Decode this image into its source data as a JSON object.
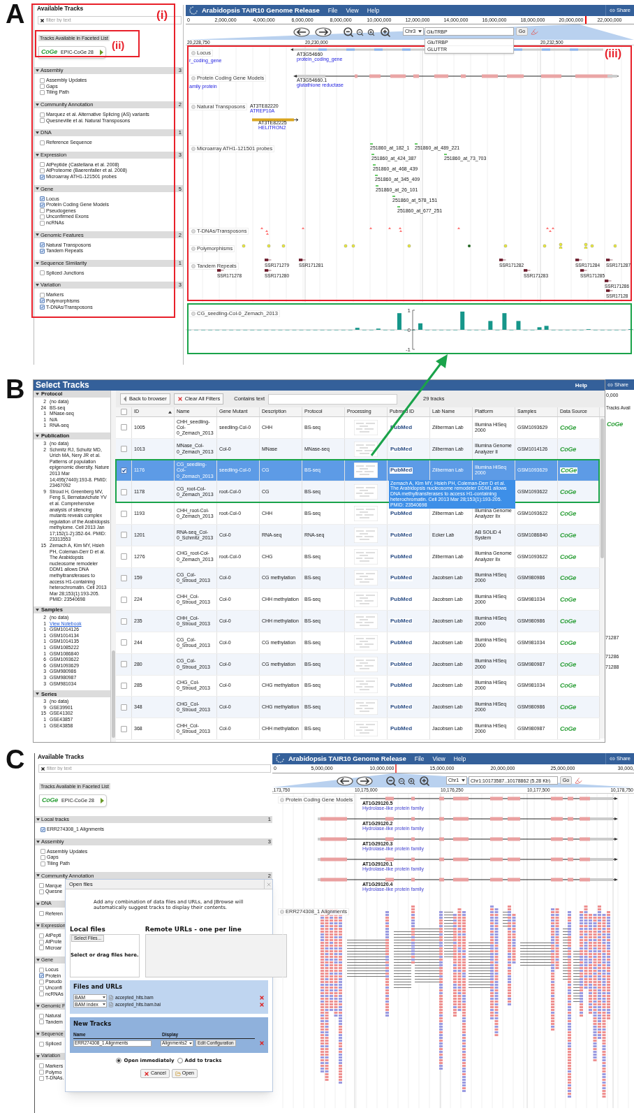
{
  "panel_a": {
    "label": "A",
    "callouts": [
      "(i)",
      "(ii)",
      "(iii)"
    ],
    "sidebar": {
      "title": "Available Tracks",
      "filter_placeholder": "filter by text",
      "faceted_label": "Tracks Available in Faceted List",
      "source": {
        "logo": "CoGe",
        "label": "EPIC-CoGe 28"
      },
      "categories": [
        {
          "name": "Assembly",
          "count": "3",
          "tracks": [
            {
              "label": "Assembly Updates",
              "checked": false
            },
            {
              "label": "Gaps",
              "checked": false
            },
            {
              "label": "Tiling Path",
              "checked": false
            }
          ]
        },
        {
          "name": "Community Annotation",
          "count": "2",
          "tracks": [
            {
              "label": "Marquez et al. Alternative Splicing (AS) variants",
              "checked": false
            },
            {
              "label": "Quesneville et al. Natural Transposons",
              "checked": false
            }
          ]
        },
        {
          "name": "DNA",
          "count": "1",
          "tracks": [
            {
              "label": "Reference Sequence",
              "checked": false
            }
          ]
        },
        {
          "name": "Expression",
          "count": "3",
          "tracks": [
            {
              "label": "AtPeptide (Castellana et al. 2008)",
              "checked": false
            },
            {
              "label": "AtProteome (Baerenfaller et al. 2008)",
              "checked": false
            },
            {
              "label": "Microarray ATH1-121501 probes",
              "checked": true
            }
          ]
        },
        {
          "name": "Gene",
          "count": "5",
          "tracks": [
            {
              "label": "Locus",
              "checked": true
            },
            {
              "label": "Protein Coding Gene Models",
              "checked": true
            },
            {
              "label": "Pseudogenes",
              "checked": false
            },
            {
              "label": "Unconfirmed Exons",
              "checked": false
            },
            {
              "label": "ncRNAs",
              "checked": false
            }
          ]
        },
        {
          "name": "Genomic Features",
          "count": "2",
          "tracks": [
            {
              "label": "Natural Transposons",
              "checked": true
            },
            {
              "label": "Tandem Repeats",
              "checked": true
            }
          ]
        },
        {
          "name": "Sequence Similarity",
          "count": "1",
          "tracks": [
            {
              "label": "Spliced Junctions",
              "checked": false
            }
          ]
        },
        {
          "name": "Variation",
          "count": "3",
          "tracks": [
            {
              "label": "Markers",
              "checked": false
            },
            {
              "label": "Polymorphisms",
              "checked": true
            },
            {
              "label": "T-DNAs/Transposons",
              "checked": true
            }
          ]
        }
      ]
    },
    "browser": {
      "title": "Arabidopsis TAIR10 Genome Release",
      "menus": [
        "File",
        "View",
        "Help"
      ],
      "share": "Share",
      "overview_ticks": [
        "0",
        "2,000,000",
        "4,000,000",
        "6,000,000",
        "8,000,000",
        "10,000,000",
        "12,000,000",
        "14,000,000",
        "16,000,000",
        "18,000,000",
        "20,000,000",
        "22,000,000"
      ],
      "chromosome": "Chr3",
      "search": {
        "value": "GluTRBP"
      },
      "go": "Go",
      "suggestions": [
        "GluTRBP",
        "GLUTTR"
      ],
      "detail_ticks": [
        "20,228,750",
        "20,230,000",
        "20,232,500"
      ],
      "tracks": [
        {
          "kind": "gene",
          "label": "Locus",
          "features": [
            {
              "note": "r_coding_gene"
            },
            {
              "name": "AT3G54660",
              "note": "protein_coding_gene"
            }
          ]
        },
        {
          "kind": "transcript",
          "label": "Protein Coding Gene Models",
          "features": [
            {
              "note": "amily protein"
            },
            {
              "name": "AT3G54660.1",
              "note": "glutathione reductase"
            }
          ]
        },
        {
          "kind": "transposon",
          "label": "Natural Transposons",
          "features": [
            {
              "name": "AT3TE82220",
              "note": "ATREP10A"
            },
            {
              "name": "AT3TE82225",
              "note": "HELITRON2"
            }
          ]
        },
        {
          "kind": "probe",
          "label": "Microarray ATH1-121501 probes",
          "features": [
            {
              "name": "251860_at_182_1"
            },
            {
              "name": "251860_at_489_221"
            },
            {
              "name": "251860_at_424_387"
            },
            {
              "name": "251860_at_73_703"
            },
            {
              "name": "251860_at_468_439"
            },
            {
              "name": "251860_at_345_409"
            },
            {
              "name": "251860_at_26_101"
            },
            {
              "name": "251860_at_578_151"
            },
            {
              "name": "251860_at_677_251"
            }
          ]
        },
        {
          "kind": "insertion",
          "label": "T-DNAs/Transposons"
        },
        {
          "kind": "snp",
          "label": "Polymorphisms"
        },
        {
          "kind": "repeat",
          "label": "Tandem Repeats",
          "features": [
            {
              "name": "SSR171278"
            },
            {
              "name": "SSR171279"
            },
            {
              "name": "SSR171280"
            },
            {
              "name": "SSR171281"
            },
            {
              "name": "SSR171282"
            },
            {
              "name": "SSR171283"
            },
            {
              "name": "SSR171284"
            },
            {
              "name": "SSR171287"
            },
            {
              "name": "SSR171285"
            },
            {
              "name": "SSR171286"
            },
            {
              "name": "SSR17128"
            }
          ]
        }
      ],
      "chart_track": {
        "label": "CG_seedling-Col-0_Zemach_2013",
        "chart_data": {
          "type": "bar",
          "ylim": [
            -1,
            1
          ],
          "yticks": [
            -1,
            0,
            1
          ],
          "values": [
            0,
            0,
            0,
            0,
            0,
            0,
            0,
            0,
            0,
            0,
            0,
            0,
            0,
            0,
            0,
            0,
            0,
            0,
            0,
            0,
            0,
            0,
            0,
            0,
            0.1,
            0,
            0,
            0.06,
            0,
            0,
            0.85,
            0,
            0,
            0.33,
            0,
            0,
            0,
            0,
            0,
            0.93,
            0,
            0,
            0,
            0.45,
            0,
            0.85,
            0,
            0.45,
            0,
            0,
            0.13,
            0.2,
            0,
            0,
            0,
            0,
            0,
            0.03,
            0,
            0,
            0,
            0,
            0,
            0.03
          ]
        }
      }
    }
  },
  "panel_b": {
    "label": "B",
    "title": "Select Tracks",
    "help": "Help",
    "facets": [
      {
        "name": "Protocol",
        "values": [
          {
            "count": "2",
            "label": "(no data)"
          },
          {
            "count": "24",
            "label": "BS-seq"
          },
          {
            "count": "1",
            "label": "MNase-seq"
          },
          {
            "count": "1",
            "label": "N/A"
          },
          {
            "count": "1",
            "label": "RNA-seq"
          }
        ]
      },
      {
        "name": "Publication",
        "values": [
          {
            "count": "3",
            "label": "(no data)"
          },
          {
            "count": "2",
            "label": "Schmitz RJ, Schultz MD, Urich MA, Nery JR et al. Patterns of population epigenomic diversity. Nature 2013 Mar 14;495(7440):193-8. PMID: 23467092"
          },
          {
            "count": "9",
            "label": "Stroud H, Greenberg MV, Feng S, Bernatavichute YV et al. Comprehensive analysis of silencing mutants reveals complex regulation of the Arabidopsis methylome. Cell 2013 Jan 17;152(1-2):352-64. PMID: 23313553"
          },
          {
            "count": "15",
            "label": "Zemach A, Kim MY, Hsieh PH, Coleman-Derr D et al. The Arabidopsis nucleosome remodeler DDM1 allows DNA methyltransferases to access H1-containing heterochromatin. Cell 2013 Mar 28;153(1):193-205. PMID: 23540698"
          }
        ]
      },
      {
        "name": "Samples",
        "values": [
          {
            "kind": "text",
            "count": "2",
            "label": "(no data)"
          },
          {
            "kind": "link",
            "count": "1",
            "label": "View Notebook"
          },
          {
            "kind": "text",
            "count": "1",
            "label": "GSM1014126"
          },
          {
            "kind": "text",
            "count": "1",
            "label": "GSM1014134"
          },
          {
            "kind": "text",
            "count": "1",
            "label": "GSM1014135"
          },
          {
            "kind": "text",
            "count": "1",
            "label": "GSM1085222"
          },
          {
            "kind": "text",
            "count": "1",
            "label": "GSM1086840"
          },
          {
            "kind": "text",
            "count": "6",
            "label": "GSM1093622"
          },
          {
            "kind": "text",
            "count": "6",
            "label": "GSM1093629"
          },
          {
            "kind": "text",
            "count": "3",
            "label": "GSM980986"
          },
          {
            "kind": "text",
            "count": "3",
            "label": "GSM980987"
          },
          {
            "kind": "text",
            "count": "3",
            "label": "GSM981034"
          }
        ]
      },
      {
        "name": "Series",
        "values": [
          {
            "count": "3",
            "label": "(no data)"
          },
          {
            "count": "9",
            "label": "GSE39901"
          },
          {
            "count": "15",
            "label": "GSE41302"
          },
          {
            "count": "1",
            "label": "GSE43857"
          },
          {
            "count": "1",
            "label": "GSE43858"
          }
        ]
      }
    ],
    "select_all": {
      "checked": false
    },
    "toolbar": {
      "back": "Back to browser",
      "clear": "Clear All Filters",
      "filter_label": "Contains text",
      "count": "29 tracks"
    },
    "columns": [
      {
        "label": "ID",
        "sorted": true
      },
      {
        "label": "Name",
        "sorted": false
      },
      {
        "label": "Gene Mutant",
        "sorted": false
      },
      {
        "label": "Description",
        "sorted": false
      },
      {
        "label": "Protocol",
        "sorted": false
      },
      {
        "label": "Processing",
        "sorted": false
      },
      {
        "label": "Pubmed ID",
        "sorted": false
      },
      {
        "label": "Lab Name",
        "sorted": false
      },
      {
        "label": "Platform",
        "sorted": false
      },
      {
        "label": "Samples",
        "sorted": false
      },
      {
        "label": "Data Source",
        "sorted": false
      }
    ],
    "rows": [
      {
        "selected": false,
        "checked": false,
        "id": "1005",
        "name": "CHH_seedling-Col-0_Zemach_2013",
        "mutant": "seedling-Col-0",
        "description": "CHH",
        "protocol": "BS-seq",
        "pubmed": "PubMed",
        "lab": "Zilberman Lab",
        "platform": "Illumina HiSeq 2000",
        "samples": "GSM1093629",
        "source": "CoGe"
      },
      {
        "selected": false,
        "checked": false,
        "id": "1013",
        "name": "MNase_Col-0_Zemach_2013",
        "mutant": "Col-0",
        "description": "MNase",
        "protocol": "MNase-seq",
        "pubmed": "PubMed",
        "lab": "Zilberman Lab",
        "platform": "Illumina Genome Analyzer II",
        "samples": "GSM1014126",
        "source": "CoGe"
      },
      {
        "selected": true,
        "checked": true,
        "id": "1176",
        "name": "CG_seedling-Col-0_Zemach_2013",
        "mutant": "seedling-Col-0",
        "description": "CG",
        "protocol": "BS-seq",
        "pubmed": "PubMed",
        "lab": "Zilberman Lab",
        "platform": "Illumina HiSeq 2000",
        "samples": "GSM1093629",
        "source": "CoGe",
        "tooltip": "Zemach A, Kim MY, Hsieh PH, Coleman-Derr D et al. The Arabidopsis nucleosome remodeler DDM1 allows DNA methyltransferases to access H1-containing heterochromatin. Cell 2013 Mar 28;153(1):193-205. PMID: 23540698"
      },
      {
        "selected": false,
        "checked": false,
        "id": "1178",
        "name": "CG_root-Col-0_Zemach_2013",
        "mutant": "root-Col-0",
        "description": "CG",
        "protocol": "BS-seq",
        "samples": "GSM1093622",
        "source": "CoGe"
      },
      {
        "selected": false,
        "checked": false,
        "id": "1193",
        "name": "CHH_root-Col-0_Zemach_2013",
        "mutant": "root-Col-0",
        "description": "CHH",
        "protocol": "BS-seq",
        "pubmed": "PubMed",
        "lab": "Zilberman Lab",
        "platform": "Illumina Genome Analyzer IIx",
        "samples": "GSM1093622",
        "source": "CoGe"
      },
      {
        "selected": false,
        "checked": false,
        "id": "1201",
        "name": "RNA-seq_Col-0_Schmitz_2013",
        "mutant": "Col-0",
        "description": "RNA-seq",
        "protocol": "RNA-seq",
        "pubmed": "PubMed",
        "lab": "Ecker Lab",
        "platform": "AB SOLiD 4 System",
        "samples": "GSM1086840",
        "source": "CoGe"
      },
      {
        "selected": false,
        "checked": false,
        "id": "1276",
        "name": "CHG_root-Col-0_Zemach_2013",
        "mutant": "root-Col-0",
        "description": "CHG",
        "protocol": "BS-seq",
        "pubmed": "PubMed",
        "lab": "Zilberman Lab",
        "platform": "Illumina Genome Analyzer IIx",
        "samples": "GSM1093622",
        "source": "CoGe"
      },
      {
        "selected": false,
        "checked": false,
        "id": "159",
        "name": "CG_Col-0_Stroud_2013",
        "mutant": "Col-0",
        "description": "CG methylation",
        "protocol": "BS-seq",
        "pubmed": "PubMed",
        "lab": "Jacobsen Lab",
        "platform": "Illumina HiSeq 2000",
        "samples": "GSM980986",
        "source": "CoGe"
      },
      {
        "selected": false,
        "checked": false,
        "id": "224",
        "name": "CHH_Col-0_Stroud_2013",
        "mutant": "Col-0",
        "description": "CHH methylation",
        "protocol": "BS-seq",
        "pubmed": "PubMed",
        "lab": "Jacobsen Lab",
        "platform": "Illumina HiSeq 2000",
        "samples": "GSM981034",
        "source": "CoGe"
      },
      {
        "selected": false,
        "checked": false,
        "id": "235",
        "name": "CHH_Col-0_Stroud_2013",
        "mutant": "Col-0",
        "description": "CHH methylation",
        "protocol": "BS-seq",
        "pubmed": "PubMed",
        "lab": "Jacobsen Lab",
        "platform": "Illumina HiSeq 2000",
        "samples": "GSM980986",
        "source": "CoGe"
      },
      {
        "selected": false,
        "checked": false,
        "id": "244",
        "name": "CG_Col-0_Stroud_2013",
        "mutant": "Col-0",
        "description": "CG methylation",
        "protocol": "BS-seq",
        "pubmed": "PubMed",
        "lab": "Jacobsen Lab",
        "platform": "Illumina HiSeq 2000",
        "samples": "GSM981034",
        "source": "CoGe"
      },
      {
        "selected": false,
        "checked": false,
        "id": "280",
        "name": "CG_Col-0_Stroud_2013",
        "mutant": "Col-0",
        "description": "CG methylation",
        "protocol": "BS-seq",
        "pubmed": "PubMed",
        "lab": "Jacobsen Lab",
        "platform": "Illumina HiSeq 2000",
        "samples": "GSM980987",
        "source": "CoGe"
      },
      {
        "selected": false,
        "checked": false,
        "id": "285",
        "name": "CHG_Col-0_Stroud_2013",
        "mutant": "Col-0",
        "description": "CHG methylation",
        "protocol": "BS-seq",
        "pubmed": "PubMed",
        "lab": "Jacobsen Lab",
        "platform": "Illumina HiSeq 2000",
        "samples": "GSM981034",
        "source": "CoGe"
      },
      {
        "selected": false,
        "checked": false,
        "id": "348",
        "name": "CHG_Col-0_Stroud_2013",
        "mutant": "Col-0",
        "description": "CHG methylation",
        "protocol": "BS-seq",
        "pubmed": "PubMed",
        "lab": "Jacobsen Lab",
        "platform": "Illumina HiSeq 2000",
        "samples": "GSM980986",
        "source": "CoGe"
      },
      {
        "selected": false,
        "checked": false,
        "id": "368",
        "name": "CHH_Col-0_Stroud_2013",
        "mutant": "Col-0",
        "description": "CHH methylation",
        "protocol": "BS-seq",
        "pubmed": "PubMed",
        "lab": "Jacobsen Lab",
        "platform": "Illumina HiSeq 2000",
        "samples": "GSM980987",
        "source": "CoGe"
      }
    ],
    "background_window": {
      "share": "Share",
      "ruler": "0,000",
      "tracks_label": "Tracks Avail",
      "logo": "CoGe",
      "labels": [
        "71287",
        "71286",
        "71288"
      ]
    }
  },
  "panel_c": {
    "label": "C",
    "sidebar": {
      "title": "Available Tracks",
      "filter_placeholder": "filter by text",
      "faceted_label": "Tracks Available in Faceted List",
      "source": {
        "logo": "CoGe",
        "label": "EPIC-CoGe 28"
      },
      "categories": [
        {
          "name": "Local tracks",
          "count": "1",
          "tracks": [
            {
              "label": "ERR274308_1 Alignments",
              "checked": true
            }
          ]
        },
        {
          "name": "Assembly",
          "count": "3",
          "tracks": [
            {
              "label": "Assembly Updates",
              "checked": false
            },
            {
              "label": "Gaps",
              "checked": false
            },
            {
              "label": "Tiling Path",
              "checked": false
            }
          ]
        },
        {
          "name": "Community Annotation",
          "count": "2",
          "tracks": [
            {
              "label": "Marque",
              "checked": false
            },
            {
              "label": "Quesne",
              "checked": false
            }
          ]
        },
        {
          "name": "DNA",
          "tracks": [
            {
              "label": "Referen",
              "checked": false
            }
          ]
        },
        {
          "name": "Expression",
          "tracks": [
            {
              "label": "AtPepti",
              "checked": false
            },
            {
              "label": "AtProte",
              "checked": false
            },
            {
              "label": "Microar",
              "checked": false
            }
          ]
        },
        {
          "name": "Gene",
          "tracks": [
            {
              "label": "Locus",
              "checked": false
            },
            {
              "label": "Protein",
              "checked": true
            },
            {
              "label": "Pseudo",
              "checked": false
            },
            {
              "label": "Unconfi",
              "checked": false
            },
            {
              "label": "ncRNAs",
              "checked": false
            }
          ]
        },
        {
          "name": "Genomic F",
          "tracks": [
            {
              "label": "Natural",
              "checked": false
            },
            {
              "label": "Tandem",
              "checked": false
            }
          ]
        },
        {
          "name": "Sequence",
          "tracks": [
            {
              "label": "Spliced",
              "checked": false
            }
          ]
        },
        {
          "name": "Variation",
          "tracks": [
            {
              "label": "Markers",
              "checked": false
            },
            {
              "label": "Polymo",
              "checked": false
            },
            {
              "label": "T-DNAs.",
              "checked": false
            }
          ]
        }
      ]
    },
    "dialog": {
      "title": "Open files",
      "intro": "Add any combination of data files and URLs, and JBrowse will automatically suggest tracks to display their contents.",
      "local_heading": "Local files",
      "select_button": "Select Files...",
      "drop_hint": "Select or drag files here.",
      "remote_heading": "Remote URLs - one per line",
      "files_heading": "Files and URLs",
      "files": [
        {
          "type": "BAM",
          "name": "accepted_hits.bam"
        },
        {
          "type": "BAM index",
          "name": "accepted_hits.bam.bai"
        }
      ],
      "tracks_heading": "New Tracks",
      "name_column": "Name",
      "display_column": "Display",
      "track": {
        "name": "ERR274308_1 Alignments",
        "display": "Alignments2",
        "configure": "Edit Configuration"
      },
      "open_options": [
        {
          "label": "Open immediately",
          "selected": true
        },
        {
          "label": "Add to tracks",
          "selected": false
        }
      ],
      "buttons": [
        {
          "kind": "cancel",
          "label": "Cancel"
        },
        {
          "kind": "open",
          "label": "Open"
        }
      ]
    },
    "browser": {
      "title": "Arabidopsis TAIR10 Genome Release",
      "menus": [
        "File",
        "View",
        "Help"
      ],
      "share": "Share",
      "overview_ticks": [
        "0",
        "5,000,000",
        "10,000,000",
        "15,000,000",
        "20,000,000",
        "25,000,000",
        "30,000,"
      ],
      "chromosome": "Chr1",
      "search": {
        "value": "Chr1:10173587..10178862 (5.28 Kb)"
      },
      "go": "Go",
      "detail_ticks": [
        ",173,750",
        "10,175,000",
        "10,176,250",
        "10,177,500",
        "10,178,750"
      ],
      "gene_track": {
        "label": "Protein Coding Gene Models",
        "transcripts": [
          {
            "name": "AT1G29120.5",
            "description": "Hydrolase-like protein family"
          },
          {
            "name": "AT1G29120.2",
            "description": "Hydrolase-like protein family"
          },
          {
            "name": "AT1G29120.3",
            "description": "Hydrolase-like protein family"
          },
          {
            "name": "AT1G29120.1",
            "description": "Hydrolase-like protein family"
          },
          {
            "name": "AT1G29120.4",
            "description": "Hydrolase-like protein family"
          }
        ]
      },
      "alignment_track": {
        "label": "ERR274308_1 Alignments"
      }
    }
  }
}
